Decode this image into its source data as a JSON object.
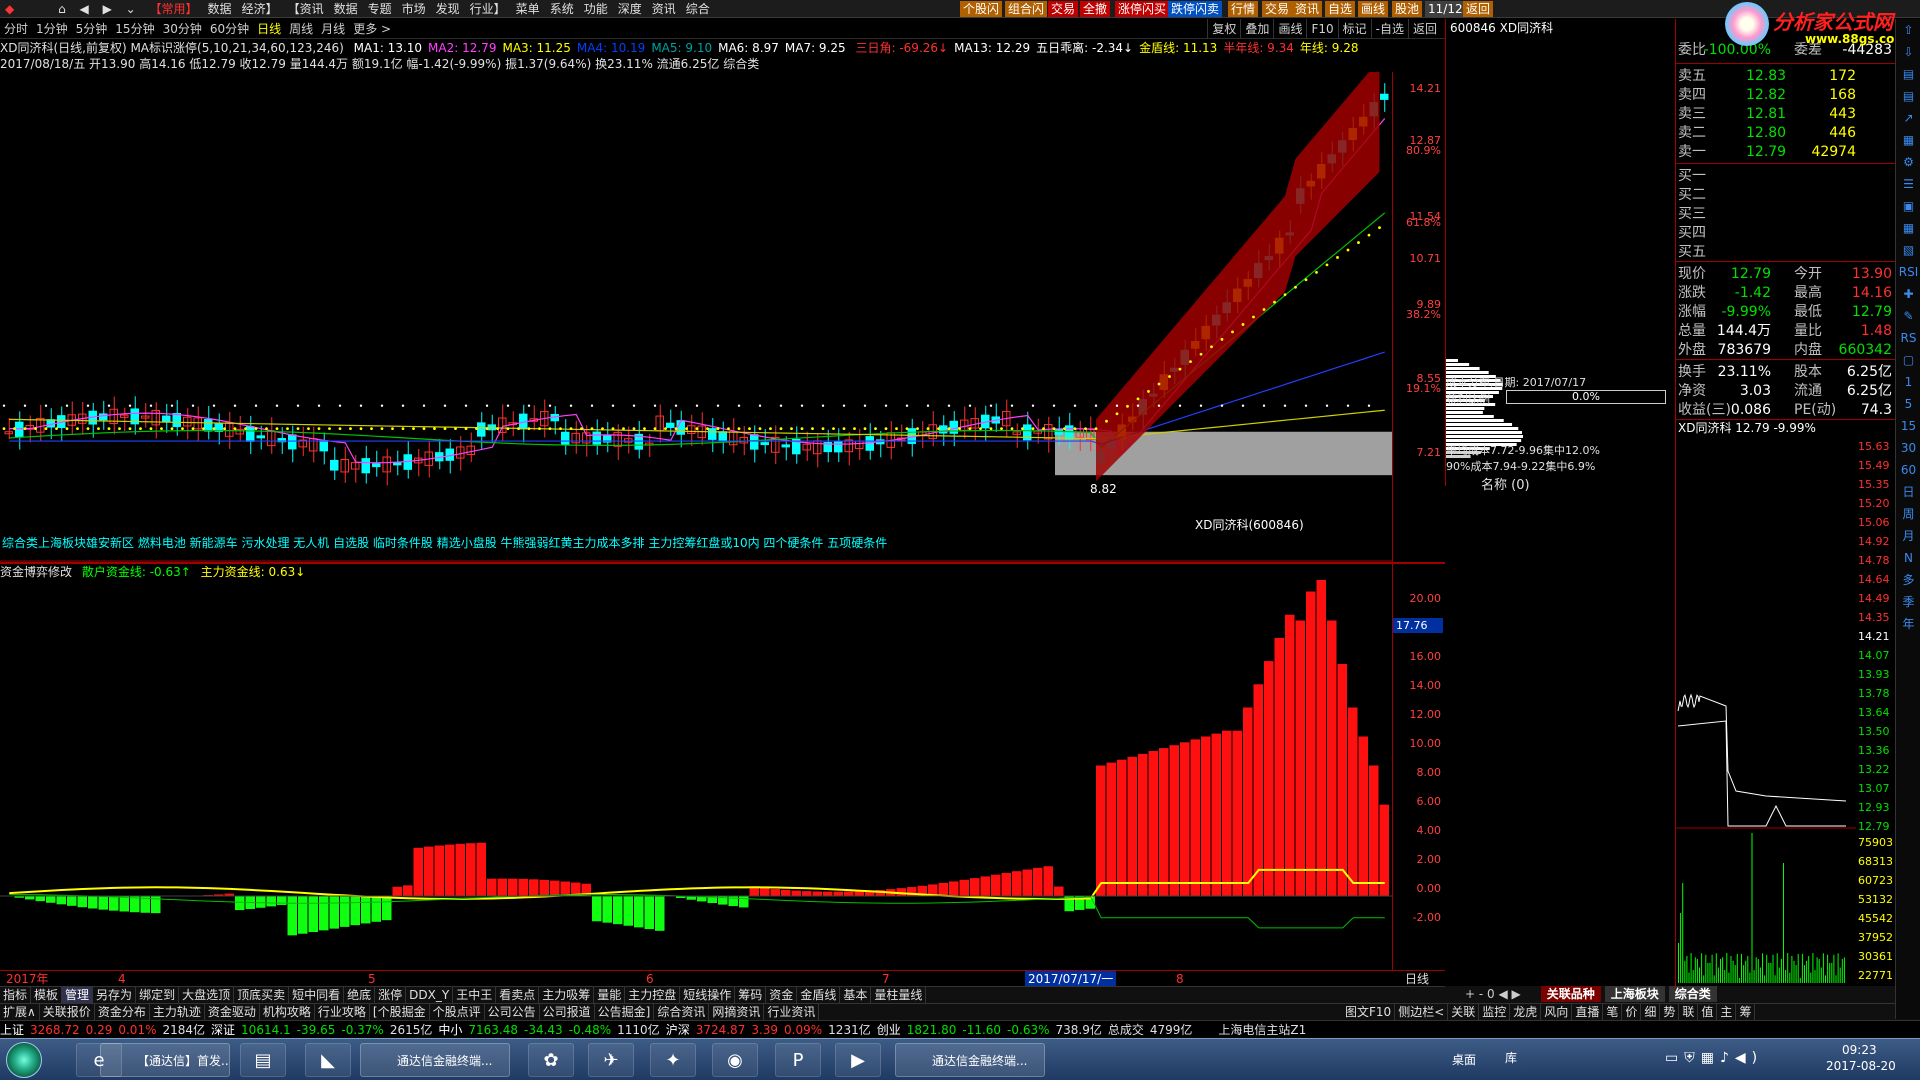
{
  "menu": {
    "items": [
      "【常用】",
      "数据",
      "经济】",
      "【资讯",
      "数据",
      "专题",
      "市场",
      "发现",
      "行业】",
      "菜单",
      "系统",
      "功能",
      "深度",
      "资讯",
      "综合"
    ],
    "quick": [
      "个股闪",
      "组合闪",
      "交易",
      "全撤",
      "涨停闪买",
      "跌停闪卖",
      "行情",
      "交易",
      "资讯",
      "自选",
      "画线",
      "股池",
      "11/12",
      "返回"
    ]
  },
  "period": {
    "items": [
      "分时",
      "1分钟",
      "5分钟",
      "15分钟",
      "30分钟",
      "60分钟",
      "日线",
      "周线",
      "月线",
      "更多 >"
    ],
    "active": "日线",
    "tools": [
      "复权",
      "叠加",
      "画线",
      "F10",
      "标记",
      "-自选",
      "返回"
    ]
  },
  "stock": {
    "code": "600846",
    "name": "XD同济科",
    "header": "600846 XD同济科",
    "chart_title": "XD同济科(日线,前复权) MA标识涨停(5,10,21,34,60,123,246)",
    "ma": [
      "MA1: 13.10",
      "MA2: 12.79",
      "MA3: 11.25",
      "MA4: 10.19",
      "MA5: 9.10",
      "MA6: 8.97",
      "MA7: 9.25"
    ],
    "extra": [
      "三日角: -69.26↓",
      "MA13: 12.29",
      "五日乖离: -2.34↓",
      "金盾线: 11.13",
      "半年线: 9.34",
      "年线: 9.28"
    ],
    "ohlc": "2017/08/18/五 开13.90 高14.16 低12.79 收12.79 量144.4万 额19.1亿 幅-1.42(-9.99%) 振1.37(9.64%) 换23.11% 流通6.25亿 综合类",
    "concepts": "综合类上海板块雄安新区 燃料电池 新能源车 污水处理 无人机 自选股 临时条件股 精选小盘股 牛熊强弱红黄主力成本多排 主力控筹红盘或10内 四个硬条件 五项硬条件",
    "label_low": "8.82",
    "label_name": "XD同济科(600846)"
  },
  "indicator": {
    "name": "资金博弈修改",
    "lines": [
      "散户资金线: -0.63↑",
      "主力资金线: 0.63↓"
    ],
    "current": "17.76"
  },
  "axis": {
    "price": [
      "14.21",
      "12.87",
      "11.54",
      "10.71",
      "9.89",
      "8.55",
      "7.21"
    ],
    "pct": [
      "80.9%",
      "61.8%",
      "38.2%",
      "19.1%"
    ],
    "ind": [
      "20.00",
      "18.00",
      "16.00",
      "14.00",
      "12.00",
      "10.00",
      "8.00",
      "6.00",
      "4.00",
      "2.00",
      "0.00",
      "-2.00"
    ]
  },
  "dates": {
    "labels": [
      "2017年",
      "4",
      "5",
      "6",
      "7",
      "8"
    ],
    "cursor": "2017/07/17/一",
    "period": "日线"
  },
  "chart_data": {
    "type": "candlestick",
    "title": "XD同济科(日线,前复权)",
    "last": {
      "open": 13.9,
      "high": 14.16,
      "low": 12.79,
      "close": 12.79,
      "volume": "144.4万"
    }
  },
  "chip": {
    "title": "成本分布,日期: 2017/07/17",
    "profit_label": "获利比例",
    "profit": "0.0%",
    "lines": [
      "平均成本7.72-9.96集中12.0%",
      "90%成本7.94-9.22集中6.9%"
    ],
    "footer": "名称 (0)"
  },
  "quote": {
    "rows": [
      {
        "l": "委比",
        "v": "-100.00%",
        "l2": "委差",
        "v2": "-44283"
      },
      {
        "l": "卖五",
        "p": "12.83",
        "q": "172"
      },
      {
        "l": "卖四",
        "p": "12.82",
        "q": "168"
      },
      {
        "l": "卖三",
        "p": "12.81",
        "q": "443"
      },
      {
        "l": "卖二",
        "p": "12.80",
        "q": "446"
      },
      {
        "l": "卖一",
        "p": "12.79",
        "q": "42974"
      },
      {
        "l": "买一",
        "p": "",
        "q": ""
      },
      {
        "l": "买二",
        "p": "",
        "q": ""
      },
      {
        "l": "买三",
        "p": "",
        "q": ""
      },
      {
        "l": "买四",
        "p": "",
        "q": ""
      },
      {
        "l": "买五",
        "p": "",
        "q": ""
      },
      {
        "l": "现价",
        "v": "12.79",
        "l2": "今开",
        "v2": "13.90"
      },
      {
        "l": "涨跌",
        "v": "-1.42",
        "l2": "最高",
        "v2": "14.16"
      },
      {
        "l": "涨幅",
        "v": "-9.99%",
        "l2": "最低",
        "v2": "12.79"
      },
      {
        "l": "总量",
        "v": "144.4万",
        "l2": "量比",
        "v2": "1.48"
      },
      {
        "l": "外盘",
        "v": "783679",
        "l2": "内盘",
        "v2": "660342"
      },
      {
        "l": "换手",
        "v": "23.11%",
        "l2": "股本",
        "v2": "6.25亿"
      },
      {
        "l": "净资",
        "v": "3.03",
        "l2": "流通",
        "v2": "6.25亿"
      },
      {
        "l": "收益(三)",
        "v": "0.086",
        "l2": "PE(动)",
        "v2": "74.3"
      }
    ]
  },
  "mini": {
    "title": "XD同济科 12.79 -9.99%",
    "prices": [
      "15.63",
      "15.49",
      "15.35",
      "15.20",
      "15.06",
      "14.92",
      "14.78",
      "14.64",
      "14.49",
      "14.35",
      "14.21",
      "14.07",
      "13.93",
      "13.78",
      "13.64",
      "13.50",
      "13.36",
      "13.22",
      "13.07",
      "12.93",
      "12.79"
    ],
    "vols": [
      "75903",
      "68313",
      "60723",
      "53132",
      "45542",
      "37952",
      "30361",
      "22771",
      "15181",
      "7590"
    ]
  },
  "tabs1": [
    "指标",
    "模板",
    "管理",
    "另存为",
    "绑定到",
    "大盘选顶",
    "顶底买卖",
    "短中同看",
    "绝底",
    "涨停",
    "DDX_Y",
    "王中王",
    "看卖点",
    "主力吸筹",
    "量能",
    "主力控盘",
    "短线操作",
    "筹码",
    "资金",
    "金盾线",
    "基本",
    "量柱量线"
  ],
  "tabs2": [
    "扩展∧",
    "关联报价",
    "资金分布",
    "主力轨迹",
    "资金驱动",
    "机构攻略",
    "行业攻略",
    "[个股掘金",
    "个股点评",
    "公司公告",
    "公司报道",
    "公告掘金]",
    "综合资讯",
    "网摘资讯",
    "行业资讯"
  ],
  "tabs2r": [
    "图文F10",
    "侧边栏<",
    "关联",
    "监控",
    "龙虎",
    "风向",
    "直播",
    "笔",
    "价",
    "细",
    "势",
    "联",
    "值",
    "主",
    "筹"
  ],
  "rtabs": [
    "关联品种",
    "上海板块",
    "综合类"
  ],
  "ticker": {
    "items": [
      {
        "n": "上证",
        "v": "3268.72",
        "c": "0.29",
        "p": "0.01%",
        "a": "2184亿"
      },
      {
        "n": "深证",
        "v": "10614.1",
        "c": "-39.65",
        "p": "-0.37%",
        "a": "2615亿"
      },
      {
        "n": "中小",
        "v": "7163.48",
        "c": "-34.43",
        "p": "-0.48%",
        "a": "1110亿"
      },
      {
        "n": "沪深",
        "v": "3724.87",
        "c": "3.39",
        "p": "0.09%",
        "a": "1231亿"
      },
      {
        "n": "创业",
        "v": "1821.80",
        "c": "-11.60",
        "p": "-0.63%",
        "a": "738.9亿"
      }
    ],
    "total": "总成交",
    "total_v": "4799亿",
    "site": "上海电信主站Z1"
  },
  "taskbar": {
    "items": [
      "【通达信】首发...",
      "通达信金融终端...",
      "通达信金融终端..."
    ],
    "time": "09:23",
    "date": "2017-08-20",
    "desktop": "桌面",
    "lib": "库"
  },
  "logo": {
    "text": "分析家公式网",
    "url": "www.88gs.com"
  },
  "colors": {
    "up": "#ff3030",
    "down": "#00ffff",
    "green": "#00e000",
    "yellow": "#ffff00",
    "grid": "#a00000"
  }
}
